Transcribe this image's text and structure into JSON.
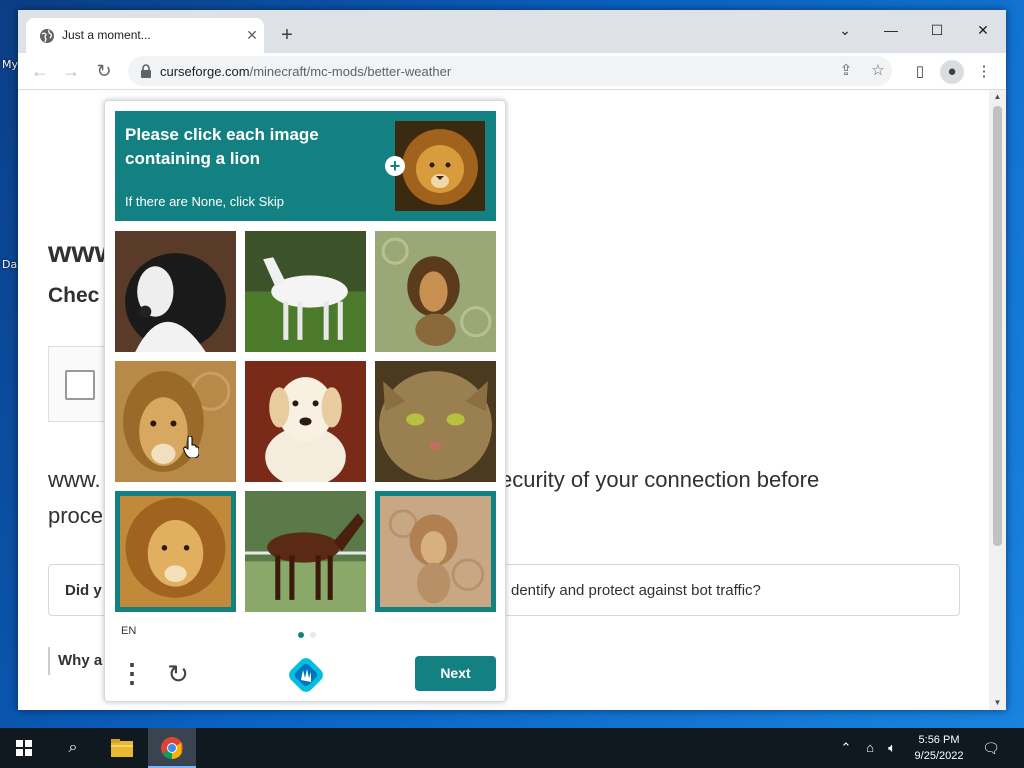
{
  "desktop": {
    "icon_labels": [
      "My",
      "Da"
    ]
  },
  "browser": {
    "tab_title": "Just a moment...",
    "url_domain": "curseforge.com",
    "url_path": "/minecraft/mc-mods/better-weather"
  },
  "page": {
    "heading": "www",
    "subheading": "Chec",
    "paragraph_start": "www.",
    "paragraph_end": "ecurity of your connection before",
    "paragraph_line2": "proce",
    "faq_start": "Did y",
    "faq_end": "dentify and protect against bot traffic?",
    "why_text": "Why a"
  },
  "captcha": {
    "title": "Please click each image containing a lion",
    "subtitle": "If there are None, click Skip",
    "language": "EN",
    "next_label": "Next",
    "accent_color": "#138082",
    "tiles": [
      {
        "subject": "dog",
        "selected": false
      },
      {
        "subject": "horse",
        "selected": false
      },
      {
        "subject": "lion",
        "selected": false
      },
      {
        "subject": "lion",
        "selected": false
      },
      {
        "subject": "dog",
        "selected": false
      },
      {
        "subject": "cat",
        "selected": false
      },
      {
        "subject": "lion",
        "selected": true
      },
      {
        "subject": "horse",
        "selected": false
      },
      {
        "subject": "lion",
        "selected": true
      }
    ],
    "page_dots": 2,
    "active_dot": 0
  },
  "taskbar": {
    "time": "5:56 PM",
    "date": "9/25/2022"
  }
}
